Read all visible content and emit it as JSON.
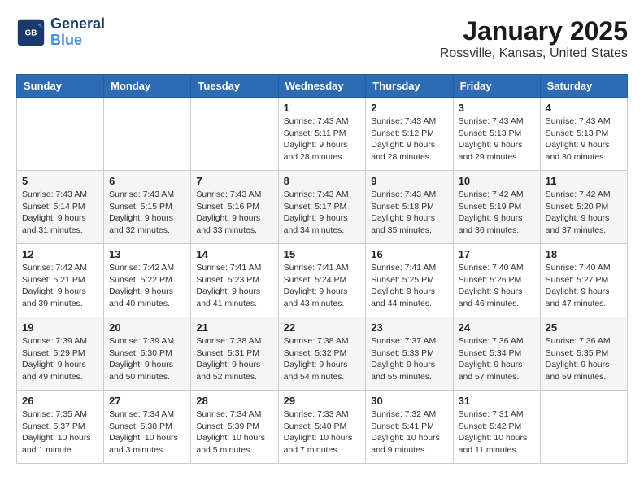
{
  "header": {
    "logo_line1": "General",
    "logo_line2": "Blue",
    "month": "January 2025",
    "location": "Rossville, Kansas, United States"
  },
  "weekdays": [
    "Sunday",
    "Monday",
    "Tuesday",
    "Wednesday",
    "Thursday",
    "Friday",
    "Saturday"
  ],
  "weeks": [
    [
      {
        "day": "",
        "info": ""
      },
      {
        "day": "",
        "info": ""
      },
      {
        "day": "",
        "info": ""
      },
      {
        "day": "1",
        "info": "Sunrise: 7:43 AM\nSunset: 5:11 PM\nDaylight: 9 hours\nand 28 minutes."
      },
      {
        "day": "2",
        "info": "Sunrise: 7:43 AM\nSunset: 5:12 PM\nDaylight: 9 hours\nand 28 minutes."
      },
      {
        "day": "3",
        "info": "Sunrise: 7:43 AM\nSunset: 5:13 PM\nDaylight: 9 hours\nand 29 minutes."
      },
      {
        "day": "4",
        "info": "Sunrise: 7:43 AM\nSunset: 5:13 PM\nDaylight: 9 hours\nand 30 minutes."
      }
    ],
    [
      {
        "day": "5",
        "info": "Sunrise: 7:43 AM\nSunset: 5:14 PM\nDaylight: 9 hours\nand 31 minutes."
      },
      {
        "day": "6",
        "info": "Sunrise: 7:43 AM\nSunset: 5:15 PM\nDaylight: 9 hours\nand 32 minutes."
      },
      {
        "day": "7",
        "info": "Sunrise: 7:43 AM\nSunset: 5:16 PM\nDaylight: 9 hours\nand 33 minutes."
      },
      {
        "day": "8",
        "info": "Sunrise: 7:43 AM\nSunset: 5:17 PM\nDaylight: 9 hours\nand 34 minutes."
      },
      {
        "day": "9",
        "info": "Sunrise: 7:43 AM\nSunset: 5:18 PM\nDaylight: 9 hours\nand 35 minutes."
      },
      {
        "day": "10",
        "info": "Sunrise: 7:42 AM\nSunset: 5:19 PM\nDaylight: 9 hours\nand 36 minutes."
      },
      {
        "day": "11",
        "info": "Sunrise: 7:42 AM\nSunset: 5:20 PM\nDaylight: 9 hours\nand 37 minutes."
      }
    ],
    [
      {
        "day": "12",
        "info": "Sunrise: 7:42 AM\nSunset: 5:21 PM\nDaylight: 9 hours\nand 39 minutes."
      },
      {
        "day": "13",
        "info": "Sunrise: 7:42 AM\nSunset: 5:22 PM\nDaylight: 9 hours\nand 40 minutes."
      },
      {
        "day": "14",
        "info": "Sunrise: 7:41 AM\nSunset: 5:23 PM\nDaylight: 9 hours\nand 41 minutes."
      },
      {
        "day": "15",
        "info": "Sunrise: 7:41 AM\nSunset: 5:24 PM\nDaylight: 9 hours\nand 43 minutes."
      },
      {
        "day": "16",
        "info": "Sunrise: 7:41 AM\nSunset: 5:25 PM\nDaylight: 9 hours\nand 44 minutes."
      },
      {
        "day": "17",
        "info": "Sunrise: 7:40 AM\nSunset: 5:26 PM\nDaylight: 9 hours\nand 46 minutes."
      },
      {
        "day": "18",
        "info": "Sunrise: 7:40 AM\nSunset: 5:27 PM\nDaylight: 9 hours\nand 47 minutes."
      }
    ],
    [
      {
        "day": "19",
        "info": "Sunrise: 7:39 AM\nSunset: 5:29 PM\nDaylight: 9 hours\nand 49 minutes."
      },
      {
        "day": "20",
        "info": "Sunrise: 7:39 AM\nSunset: 5:30 PM\nDaylight: 9 hours\nand 50 minutes."
      },
      {
        "day": "21",
        "info": "Sunrise: 7:38 AM\nSunset: 5:31 PM\nDaylight: 9 hours\nand 52 minutes."
      },
      {
        "day": "22",
        "info": "Sunrise: 7:38 AM\nSunset: 5:32 PM\nDaylight: 9 hours\nand 54 minutes."
      },
      {
        "day": "23",
        "info": "Sunrise: 7:37 AM\nSunset: 5:33 PM\nDaylight: 9 hours\nand 55 minutes."
      },
      {
        "day": "24",
        "info": "Sunrise: 7:36 AM\nSunset: 5:34 PM\nDaylight: 9 hours\nand 57 minutes."
      },
      {
        "day": "25",
        "info": "Sunrise: 7:36 AM\nSunset: 5:35 PM\nDaylight: 9 hours\nand 59 minutes."
      }
    ],
    [
      {
        "day": "26",
        "info": "Sunrise: 7:35 AM\nSunset: 5:37 PM\nDaylight: 10 hours\nand 1 minute."
      },
      {
        "day": "27",
        "info": "Sunrise: 7:34 AM\nSunset: 5:38 PM\nDaylight: 10 hours\nand 3 minutes."
      },
      {
        "day": "28",
        "info": "Sunrise: 7:34 AM\nSunset: 5:39 PM\nDaylight: 10 hours\nand 5 minutes."
      },
      {
        "day": "29",
        "info": "Sunrise: 7:33 AM\nSunset: 5:40 PM\nDaylight: 10 hours\nand 7 minutes."
      },
      {
        "day": "30",
        "info": "Sunrise: 7:32 AM\nSunset: 5:41 PM\nDaylight: 10 hours\nand 9 minutes."
      },
      {
        "day": "31",
        "info": "Sunrise: 7:31 AM\nSunset: 5:42 PM\nDaylight: 10 hours\nand 11 minutes."
      },
      {
        "day": "",
        "info": ""
      }
    ]
  ]
}
